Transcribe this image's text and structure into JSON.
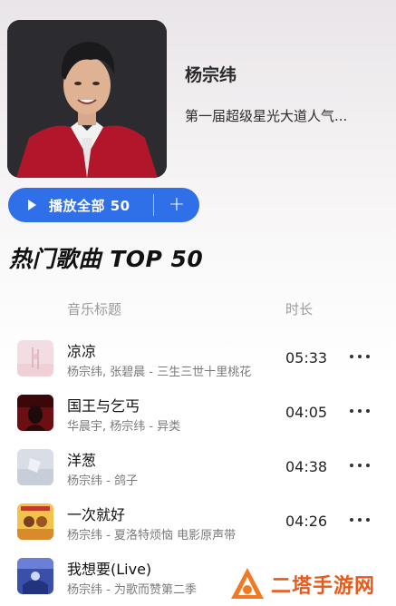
{
  "artist": {
    "name": "杨宗纬",
    "subtitle": "第一届超级星光大道人气..."
  },
  "play_all": {
    "label": "播放全部 50",
    "add_label": "+"
  },
  "section": {
    "title": "热门歌曲 TOP 50"
  },
  "columns": {
    "title": "音乐标题",
    "duration": "时长"
  },
  "songs": [
    {
      "title": "凉凉",
      "meta": "杨宗纬, 张碧晨 - 三生三世十里桃花",
      "duration": "05:33"
    },
    {
      "title": "国王与乞丐",
      "meta": "华晨宇, 杨宗纬 - 异类",
      "duration": "04:05"
    },
    {
      "title": "洋葱",
      "meta": "杨宗纬 - 鸽子",
      "duration": "04:38"
    },
    {
      "title": "一次就好",
      "meta": "杨宗纬 - 夏洛特烦恼 电影原声带",
      "duration": "04:26"
    },
    {
      "title": "我想要(Live)",
      "meta": "杨宗纬 - 为歌而赞第二季",
      "duration": ""
    }
  ],
  "watermark": {
    "text": "二塔手游网"
  },
  "colors": {
    "accent": "#2f6fe8",
    "watermark": "#e85a1c"
  }
}
